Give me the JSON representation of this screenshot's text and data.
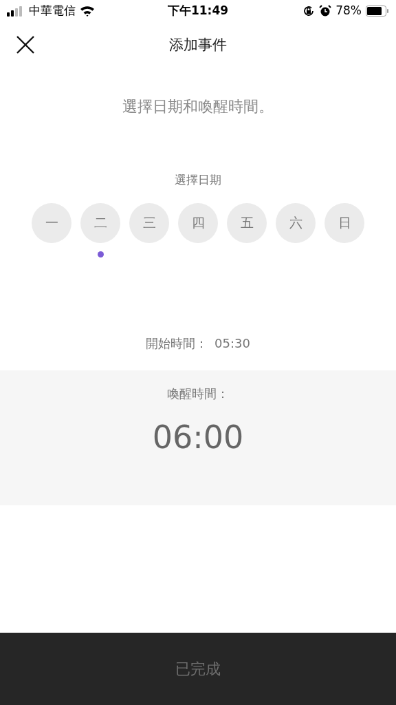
{
  "status_bar": {
    "carrier": "中華電信",
    "time": "下午11:49",
    "battery": "78%"
  },
  "header": {
    "title": "添加事件"
  },
  "instruction": "選擇日期和喚醒時間。",
  "day_picker": {
    "label": "選擇日期",
    "days": [
      {
        "label": "一",
        "selected": false,
        "today": false
      },
      {
        "label": "二",
        "selected": false,
        "today": true
      },
      {
        "label": "三",
        "selected": false,
        "today": false
      },
      {
        "label": "四",
        "selected": false,
        "today": false
      },
      {
        "label": "五",
        "selected": false,
        "today": false
      },
      {
        "label": "六",
        "selected": false,
        "today": false
      },
      {
        "label": "日",
        "selected": false,
        "today": false
      }
    ]
  },
  "start_time": {
    "label": "開始時間：",
    "value": "05:30"
  },
  "wake_time": {
    "label": "喚醒時間：",
    "value": "06:00"
  },
  "done_button": {
    "label": "已完成",
    "disabled": true
  }
}
